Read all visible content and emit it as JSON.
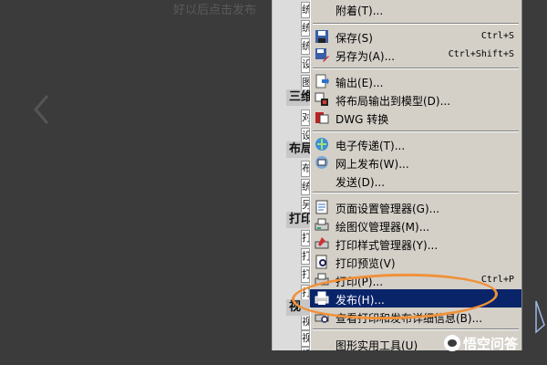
{
  "background": {
    "top_text": "好以后点击发布"
  },
  "cad_panel": {
    "rows": [
      "统",
      "统",
      "统",
      "设",
      "图",
      "对",
      "设",
      "布",
      "统",
      "另",
      "打",
      "打",
      "打",
      "打",
      "视",
      "视",
      "视",
      "视"
    ],
    "groups": [
      "三维",
      "布局",
      "打印",
      "视"
    ]
  },
  "menu": {
    "items": [
      {
        "label": "附着(T)...",
        "shortcut": "",
        "icon": ""
      },
      {
        "label": "保存(S)",
        "shortcut": "Ctrl+S",
        "icon": "save-icon"
      },
      {
        "label": "另存为(A)...",
        "shortcut": "Ctrl+Shift+S",
        "icon": "save-as-icon"
      },
      {
        "label": "输出(E)...",
        "shortcut": "",
        "icon": "export-icon"
      },
      {
        "label": "将布局输出到模型(D)...",
        "shortcut": "",
        "icon": "layout-to-model-icon"
      },
      {
        "label": "DWG 转换",
        "shortcut": "",
        "icon": "dwg-convert-icon"
      },
      {
        "label": "电子传递(T)...",
        "shortcut": "",
        "icon": "etransmit-icon"
      },
      {
        "label": "网上发布(W)...",
        "shortcut": "",
        "icon": "web-publish-icon"
      },
      {
        "label": "发送(D)...",
        "shortcut": "",
        "icon": ""
      },
      {
        "label": "页面设置管理器(G)...",
        "shortcut": "",
        "icon": "page-setup-icon"
      },
      {
        "label": "绘图仪管理器(M)...",
        "shortcut": "",
        "icon": "plotter-manager-icon"
      },
      {
        "label": "打印样式管理器(Y)...",
        "shortcut": "",
        "icon": "plot-style-icon"
      },
      {
        "label": "打印预览(V)",
        "shortcut": "",
        "icon": "plot-preview-icon"
      },
      {
        "label": "打印(P)...",
        "shortcut": "Ctrl+P",
        "icon": "print-icon"
      },
      {
        "label": "发布(H)...",
        "shortcut": "",
        "icon": "publish-icon"
      },
      {
        "label": "查看打印和发布详细信息(B)...",
        "shortcut": "",
        "icon": "plot-details-icon"
      },
      {
        "label": "图形实用工具(U)",
        "shortcut": "",
        "icon": ""
      }
    ]
  },
  "watermark": {
    "text": "悟空问答"
  },
  "colors": {
    "highlight": "#0a246a",
    "annotation_ellipse": "#f0913a",
    "menu_bg": "#d4d0c8"
  }
}
